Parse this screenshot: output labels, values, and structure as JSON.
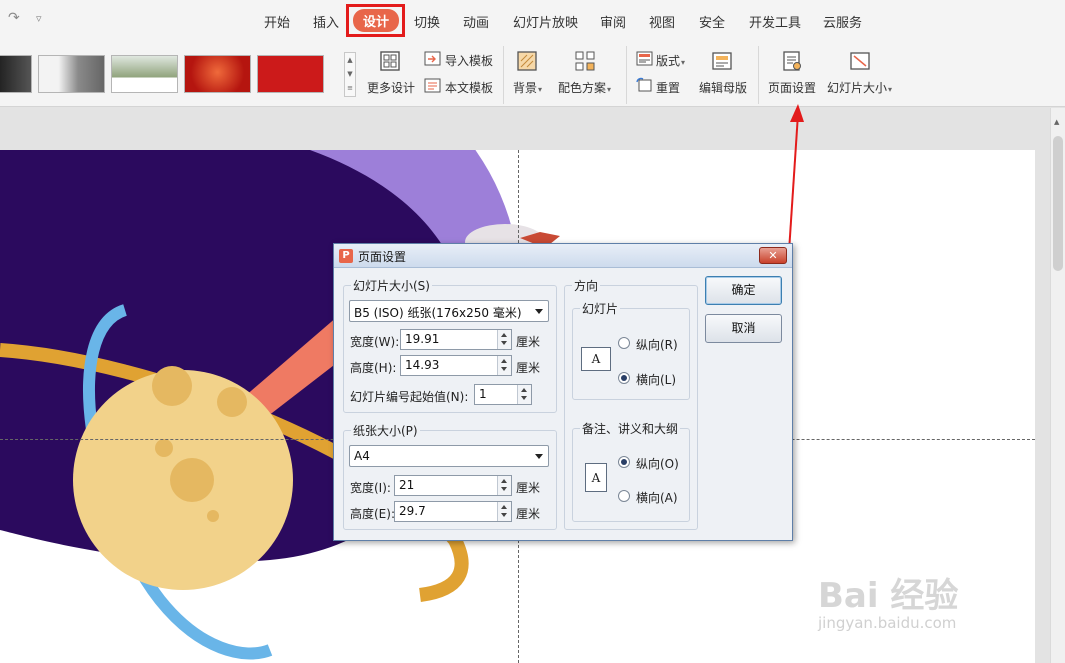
{
  "menu": {
    "tabs": [
      "开始",
      "插入",
      "设计",
      "切换",
      "动画",
      "幻灯片放映",
      "审阅",
      "视图",
      "安全",
      "开发工具",
      "云服务"
    ],
    "active_tab": "设计",
    "accent": "#e8664a",
    "highlight_color": "#e31b1b"
  },
  "ribbon": {
    "more_design": "更多设计",
    "import_template": "导入模板",
    "this_template": "本文模板",
    "background": "背景",
    "color_scheme": "配色方案",
    "layout": "版式",
    "reset": "重置",
    "edit_master": "编辑母版",
    "page_setup": "页面设置",
    "slide_size": "幻灯片大小",
    "thumbnail_count": 5
  },
  "dialog": {
    "title": "页面设置",
    "close_label": "✕",
    "slide_size_group": "幻灯片大小(S)",
    "slide_size_value": "B5 (ISO) 纸张(176x250 毫米)",
    "width_label": "宽度(W):",
    "width_value": "19.91",
    "height_label": "高度(H):",
    "height_value": "14.93",
    "unit": "厘米",
    "start_number_label": "幻灯片编号起始值(N):",
    "start_number_value": "1",
    "paper_size_group": "纸张大小(P)",
    "paper_size_value": "A4",
    "paper_width_label": "宽度(I):",
    "paper_width_value": "21",
    "paper_height_label": "高度(E):",
    "paper_height_value": "29.7",
    "orientation_group": "方向",
    "slides_subgroup": "幻灯片",
    "portrait_r": "纵向(R)",
    "landscape_l": "横向(L)",
    "notes_subgroup": "备注、讲义和大纲",
    "portrait_o": "纵向(O)",
    "landscape_a": "横向(A)",
    "slides_orientation": "横向(L)",
    "notes_orientation": "纵向(O)",
    "ok": "确定",
    "cancel": "取消"
  },
  "watermark": {
    "logo": "Bai 经验",
    "url": "jingyan.baidu.com"
  }
}
